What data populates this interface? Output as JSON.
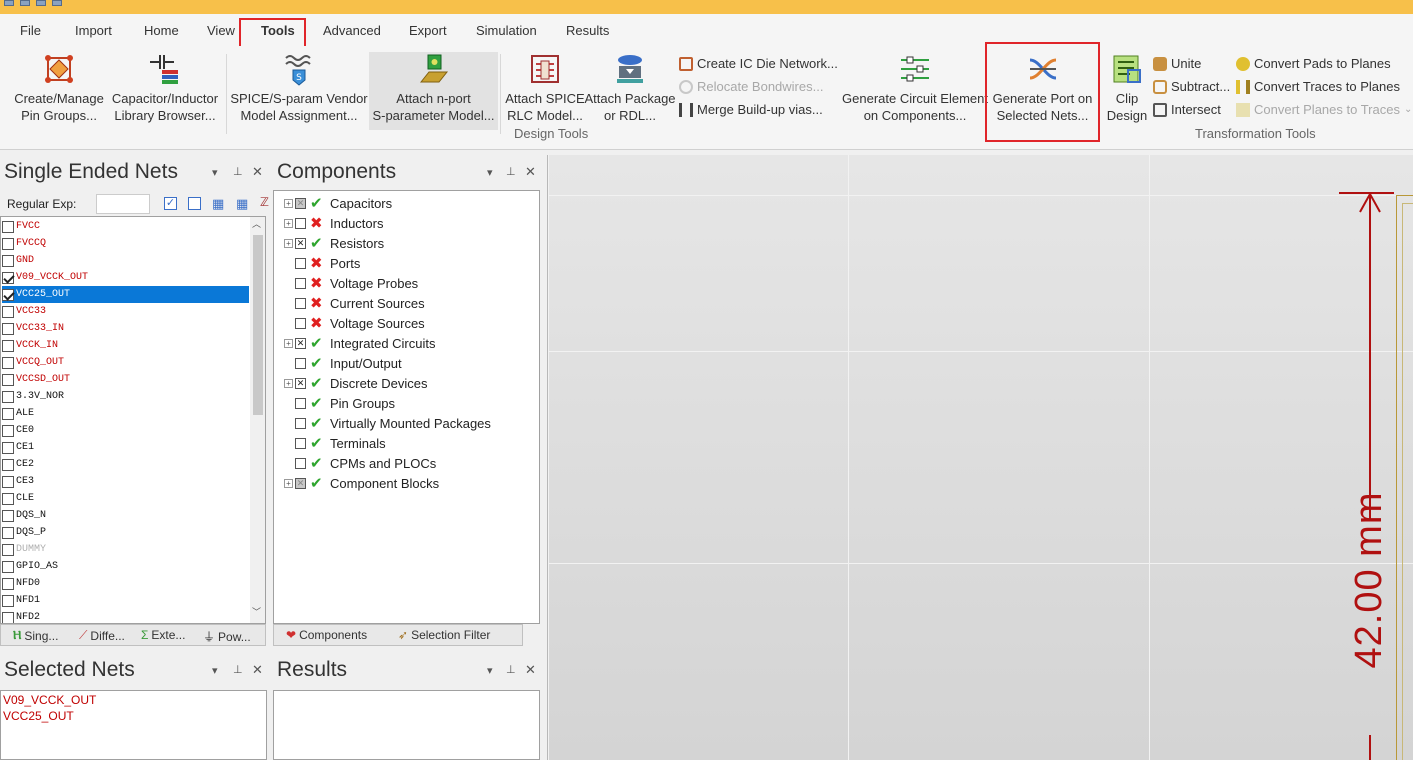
{
  "menu": [
    "File",
    "Import",
    "Home",
    "View",
    "Tools",
    "Advanced",
    "Export",
    "Simulation",
    "Results"
  ],
  "ribbon": {
    "create_manage": [
      "Create/Manage",
      "Pin Groups..."
    ],
    "cap_lib": [
      "Capacitor/Inductor",
      "Library Browser..."
    ],
    "spice_vendor": [
      "SPICE/S-param Vendor",
      "Model Assignment..."
    ],
    "attach_nport": [
      "Attach n-port",
      "S-parameter Model..."
    ],
    "attach_spice": [
      "Attach SPICE",
      "RLC Model..."
    ],
    "attach_pkg": [
      "Attach Package",
      "or RDL..."
    ],
    "create_ic_die": "Create IC Die Network...",
    "relocate_bond": "Relocate Bondwires...",
    "merge_buildup": "Merge Build-up vias...",
    "gen_circuit": [
      "Generate Circuit Element",
      "on Components..."
    ],
    "gen_port": [
      "Generate Port on",
      "Selected Nets..."
    ],
    "clip_design": [
      "Clip",
      "Design"
    ],
    "unite": "Unite",
    "subtract": "Subtract...",
    "intersect": "Intersect",
    "conv_pads": "Convert Pads to Planes",
    "conv_traces": "Convert Traces to Planes",
    "conv_planes": "Convert Planes to Traces",
    "group_design": "Design Tools",
    "group_transform": "Transformation Tools"
  },
  "single_ended": {
    "title": "Single Ended Nets",
    "regex_label": "Regular Exp:",
    "nets": [
      {
        "name": "FVCC",
        "checked": false,
        "color": "#c00000"
      },
      {
        "name": "FVCCQ",
        "checked": false,
        "color": "#c00000"
      },
      {
        "name": "GND",
        "checked": false,
        "color": "#c00000"
      },
      {
        "name": "V09_VCCK_OUT",
        "checked": true,
        "color": "#c00000"
      },
      {
        "name": "VCC25_OUT",
        "checked": true,
        "color": "#c00000",
        "selected": true
      },
      {
        "name": "VCC33",
        "checked": false,
        "color": "#c00000"
      },
      {
        "name": "VCC33_IN",
        "checked": false,
        "color": "#c00000"
      },
      {
        "name": "VCCK_IN",
        "checked": false,
        "color": "#c00000"
      },
      {
        "name": "VCCQ_OUT",
        "checked": false,
        "color": "#c00000"
      },
      {
        "name": "VCCSD_OUT",
        "checked": false,
        "color": "#c00000"
      },
      {
        "name": "3.3V_NOR",
        "checked": false,
        "color": "#111111"
      },
      {
        "name": "ALE",
        "checked": false,
        "color": "#111111"
      },
      {
        "name": "CE0",
        "checked": false,
        "color": "#111111"
      },
      {
        "name": "CE1",
        "checked": false,
        "color": "#111111"
      },
      {
        "name": "CE2",
        "checked": false,
        "color": "#111111"
      },
      {
        "name": "CE3",
        "checked": false,
        "color": "#111111"
      },
      {
        "name": "CLE",
        "checked": false,
        "color": "#111111"
      },
      {
        "name": "DQS_N",
        "checked": false,
        "color": "#111111"
      },
      {
        "name": "DQS_P",
        "checked": false,
        "color": "#111111"
      },
      {
        "name": "DUMMY",
        "checked": false,
        "color": "#b0b0b0"
      },
      {
        "name": "GPIO_AS",
        "checked": false,
        "color": "#111111"
      },
      {
        "name": "NFD0",
        "checked": false,
        "color": "#111111"
      },
      {
        "name": "NFD1",
        "checked": false,
        "color": "#111111"
      },
      {
        "name": "NFD2",
        "checked": false,
        "color": "#111111"
      }
    ],
    "tabs": [
      "Sing...",
      "Diffe...",
      "Exte...",
      "Pow..."
    ]
  },
  "components": {
    "title": "Components",
    "items": [
      {
        "label": "Capacitors",
        "exp": true,
        "cb": "gray",
        "ok": true
      },
      {
        "label": "Inductors",
        "exp": true,
        "cb": "none",
        "ok": false
      },
      {
        "label": "Resistors",
        "exp": true,
        "cb": "x",
        "ok": true
      },
      {
        "label": "Ports",
        "exp": false,
        "cb": "none",
        "ok": false
      },
      {
        "label": "Voltage Probes",
        "exp": false,
        "cb": "none",
        "ok": false
      },
      {
        "label": "Current Sources",
        "exp": false,
        "cb": "none",
        "ok": false
      },
      {
        "label": "Voltage Sources",
        "exp": false,
        "cb": "none",
        "ok": false
      },
      {
        "label": "Integrated Circuits",
        "exp": true,
        "cb": "x",
        "ok": true
      },
      {
        "label": "Input/Output",
        "exp": false,
        "cb": "none",
        "ok": true
      },
      {
        "label": "Discrete Devices",
        "exp": true,
        "cb": "x",
        "ok": true
      },
      {
        "label": "Pin Groups",
        "exp": false,
        "cb": "none",
        "ok": true
      },
      {
        "label": "Virtually Mounted Packages",
        "exp": false,
        "cb": "none",
        "ok": true
      },
      {
        "label": "Terminals",
        "exp": false,
        "cb": "none",
        "ok": true
      },
      {
        "label": "CPMs and PLOCs",
        "exp": false,
        "cb": "none",
        "ok": true
      },
      {
        "label": "Component Blocks",
        "exp": true,
        "cb": "gray",
        "ok": true
      }
    ],
    "tabs": [
      "Components",
      "Selection Filter"
    ]
  },
  "selected_nets": {
    "title": "Selected Nets",
    "nets": [
      "V09_VCCK_OUT",
      "VCC25_OUT"
    ]
  },
  "results": {
    "title": "Results"
  },
  "dimension": "42.00 mm"
}
